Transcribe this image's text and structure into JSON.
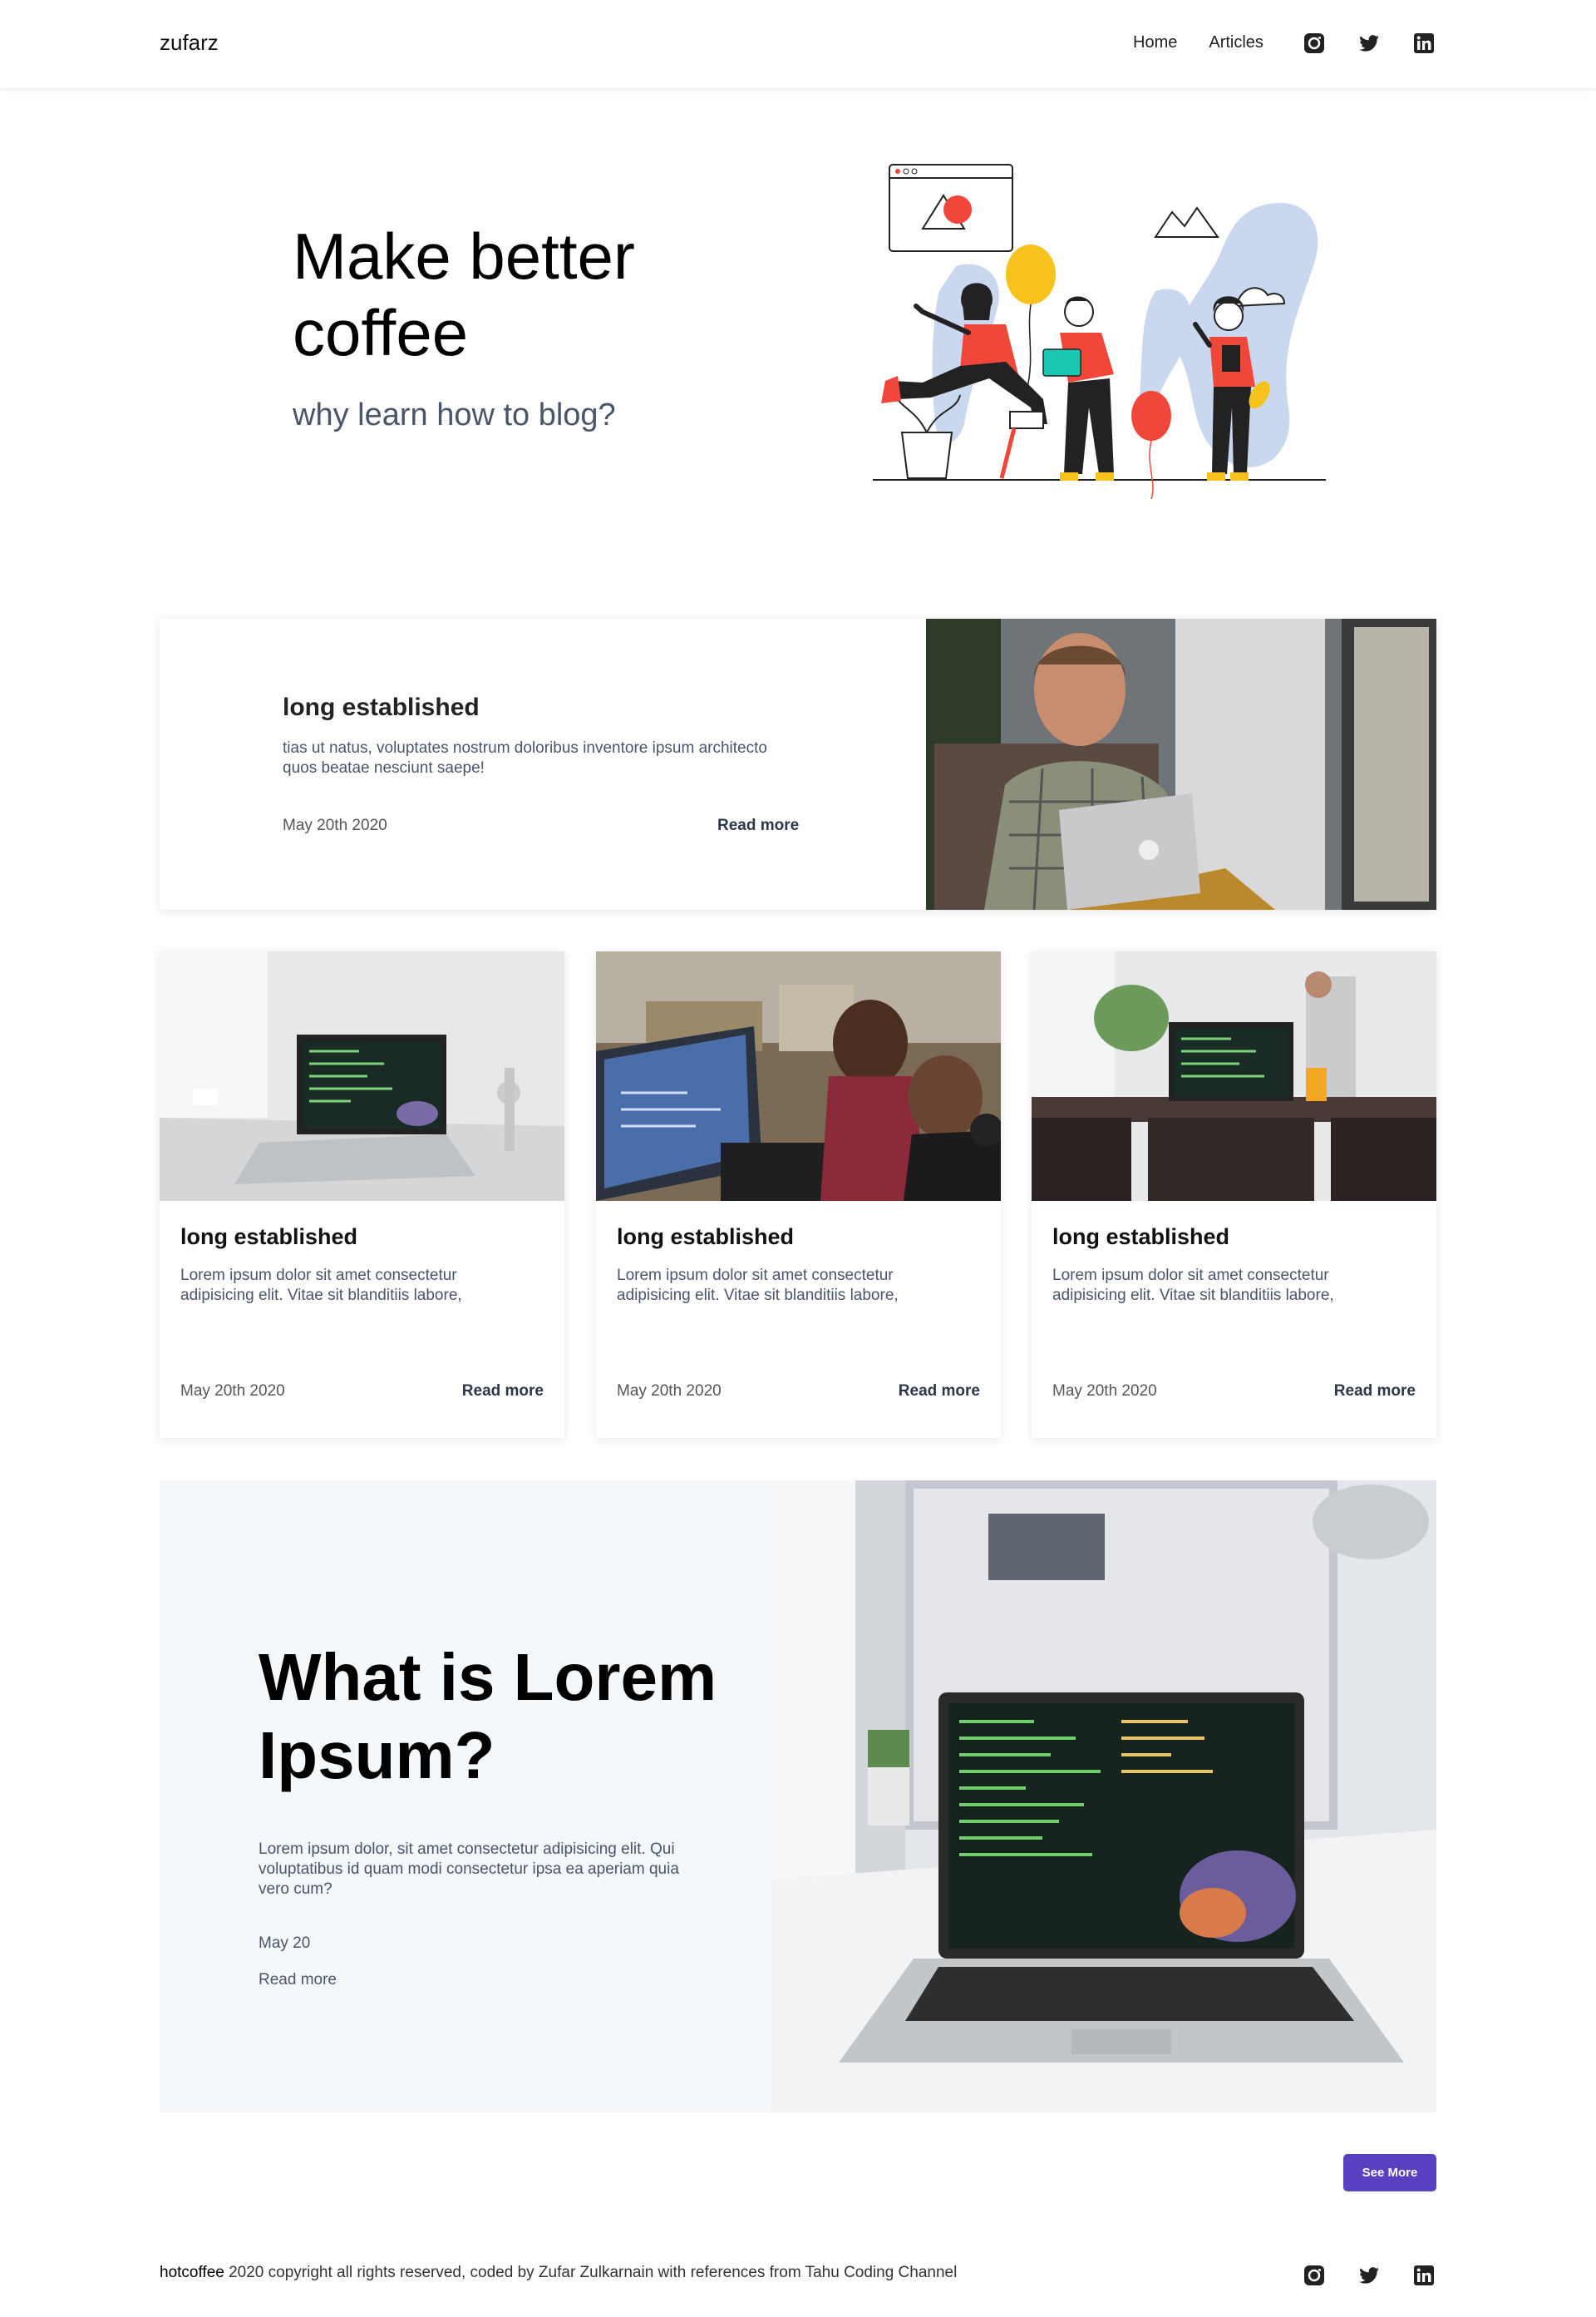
{
  "nav": {
    "brand": "zufarz",
    "links": [
      "Home",
      "Articles"
    ],
    "icons": [
      "instagram-icon",
      "twitter-icon",
      "linkedin-icon"
    ]
  },
  "hero": {
    "title": "Make better coffee",
    "subtitle": "why learn how to blog?"
  },
  "featured": {
    "title": "long established",
    "description": "tias ut natus, voluptates nostrum doloribus inventore ipsum architecto quos beatae nesciunt saepe!",
    "date": "May 20th 2020",
    "read_more": "Read more"
  },
  "cards": [
    {
      "title": "long established",
      "description": "Lorem ipsum dolor sit amet consectetur adipisicing elit. Vitae sit blanditiis labore,",
      "date": "May 20th 2020",
      "read_more": "Read more"
    },
    {
      "title": "long established",
      "description": "Lorem ipsum dolor sit amet consectetur adipisicing elit. Vitae sit blanditiis labore,",
      "date": "May 20th 2020",
      "read_more": "Read more"
    },
    {
      "title": "long established",
      "description": "Lorem ipsum dolor sit amet consectetur adipisicing elit. Vitae sit blanditiis labore,",
      "date": "May 20th 2020",
      "read_more": "Read more"
    }
  ],
  "whatis": {
    "title": "What is Lorem Ipsum?",
    "description": "Lorem ipsum dolor, sit amet consectetur adipisicing elit. Qui voluptatibus id quam modi consectetur ipsa ea aperiam quia vero cum?",
    "date": "May 20",
    "read_more": "Read more"
  },
  "see_more": "See More",
  "footer": {
    "brand": "hotcoffee",
    "text": " 2020 copyright all rights reserved, coded by Zufar Zulkarnain with references from Tahu Coding Channel"
  },
  "colors": {
    "accent": "#5a3fc0",
    "illustration_red": "#f0473a",
    "illustration_yellow": "#f7c21b",
    "illustration_blue": "#c9d8ef"
  }
}
